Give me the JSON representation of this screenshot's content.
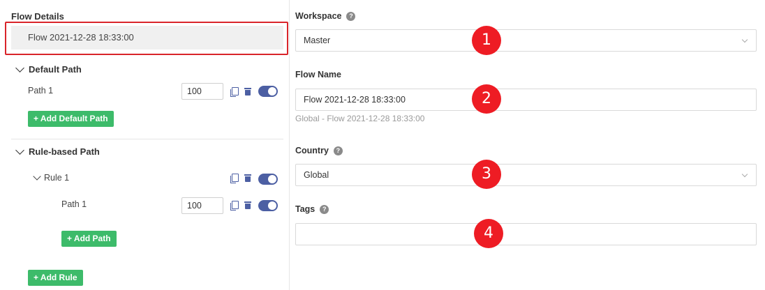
{
  "left": {
    "section_title": "Flow Details",
    "flow_name": "Flow 2021-12-28 18:33:00",
    "default_path": {
      "title": "Default Path",
      "paths": [
        {
          "label": "Path 1",
          "weight": "100",
          "enabled": true
        }
      ],
      "add_button": "+ Add Default Path"
    },
    "rule_based_path": {
      "title": "Rule-based Path",
      "rules": [
        {
          "label": "Rule 1",
          "enabled": true,
          "paths": [
            {
              "label": "Path 1",
              "weight": "100",
              "enabled": true
            }
          ],
          "add_path_button": "+ Add Path"
        }
      ],
      "add_rule_button": "+ Add Rule"
    }
  },
  "right": {
    "workspace": {
      "label": "Workspace",
      "value": "Master"
    },
    "flow_name": {
      "label": "Flow Name",
      "value": "Flow 2021-12-28 18:33:00",
      "hint": "Global - Flow 2021-12-28 18:33:00"
    },
    "country": {
      "label": "Country",
      "value": "Global"
    },
    "tags": {
      "label": "Tags",
      "value": ""
    },
    "help_glyph": "?"
  },
  "annotations": {
    "badge_1": "1",
    "badge_2": "2",
    "badge_3": "3",
    "badge_4": "4"
  },
  "colors": {
    "highlight": "#d9242a",
    "accent": "#4c5fa3",
    "add_button": "#3dbb6a",
    "badge": "#ee1c24"
  }
}
